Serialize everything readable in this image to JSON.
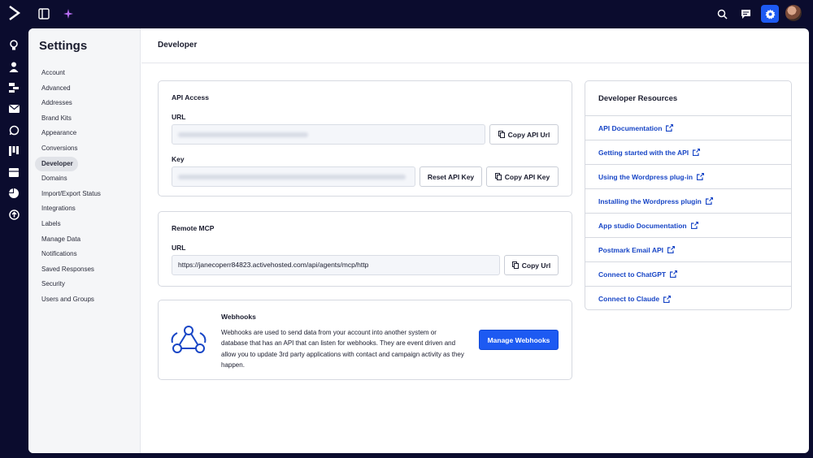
{
  "sidebar": {
    "title": "Settings",
    "items": [
      {
        "label": "Account"
      },
      {
        "label": "Advanced"
      },
      {
        "label": "Addresses"
      },
      {
        "label": "Brand Kits"
      },
      {
        "label": "Appearance"
      },
      {
        "label": "Conversions"
      },
      {
        "label": "Developer",
        "active": true
      },
      {
        "label": "Domains"
      },
      {
        "label": "Import/Export Status"
      },
      {
        "label": "Integrations"
      },
      {
        "label": "Labels"
      },
      {
        "label": "Manage Data"
      },
      {
        "label": "Notifications"
      },
      {
        "label": "Saved Responses"
      },
      {
        "label": "Security"
      },
      {
        "label": "Users and Groups"
      }
    ]
  },
  "header": {
    "title": "Developer"
  },
  "api_access": {
    "title": "API Access",
    "url_label": "URL",
    "key_label": "Key",
    "copy_url_button": "Copy API Url",
    "reset_key_button": "Reset API Key",
    "copy_key_button": "Copy API Key"
  },
  "remote_mcp": {
    "title": "Remote MCP",
    "url_label": "URL",
    "url_value": "https://janecoperr84823.activehosted.com/api/agents/mcp/http",
    "copy_button": "Copy Url"
  },
  "webhooks": {
    "title": "Webhooks",
    "description": "Webhooks are used to send data from your account into another system or database that has an API that can listen for webhooks. They are event driven and allow you to update 3rd party applications with contact and campaign activity as they happen.",
    "button": "Manage Webhooks"
  },
  "resources": {
    "title": "Developer Resources",
    "links": [
      {
        "label": "API Documentation"
      },
      {
        "label": "Getting started with the API"
      },
      {
        "label": "Using the Wordpress plug-in"
      },
      {
        "label": "Installing the Wordpress plugin"
      },
      {
        "label": "App studio Documentation"
      },
      {
        "label": "Postmark Email API"
      },
      {
        "label": "Connect to ChatGPT"
      },
      {
        "label": "Connect to Claude"
      }
    ]
  },
  "topbar_icons": [
    "logo-icon",
    "sidebar-toggle-icon",
    "sparkle-icon",
    "search-icon",
    "chat-icon",
    "gear-icon",
    "avatar"
  ],
  "rail_icons": [
    "lightbulb-icon",
    "contacts-icon",
    "automations-icon",
    "email-icon",
    "whatsapp-icon",
    "pipelines-icon",
    "forms-icon",
    "reports-icon",
    "apps-icon"
  ],
  "colors": {
    "background": "#0b0c2e",
    "accent": "#1d5af2",
    "link": "#1846c6"
  }
}
